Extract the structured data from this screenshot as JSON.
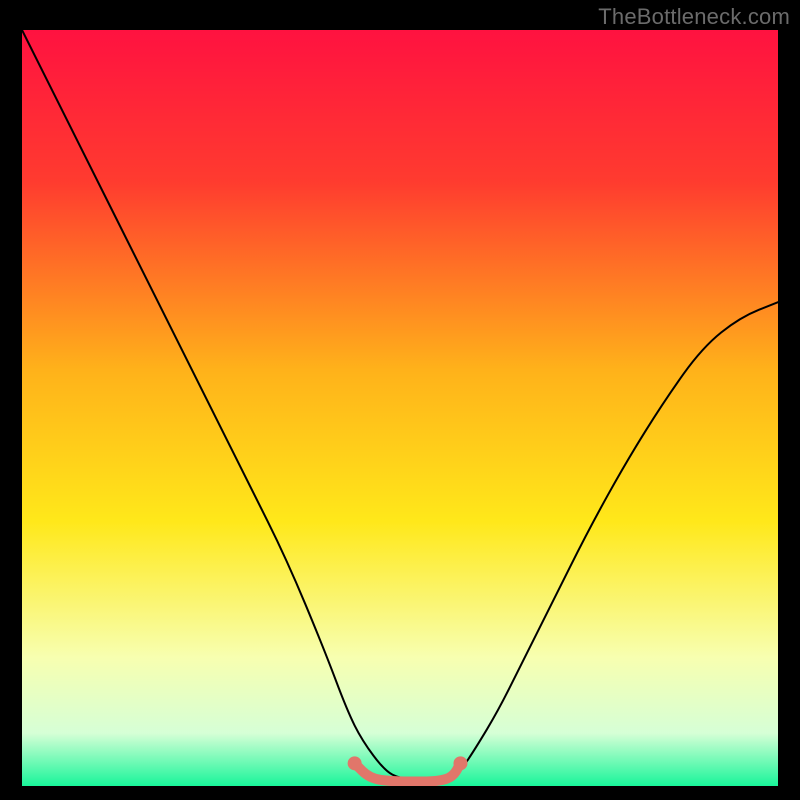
{
  "watermark": "TheBottleneck.com",
  "chart_data": {
    "type": "line",
    "title": "",
    "xlabel": "",
    "ylabel": "",
    "xlim": [
      0,
      100
    ],
    "ylim": [
      0,
      100
    ],
    "gradient_stops": [
      {
        "offset": 0,
        "color": "#ff1240"
      },
      {
        "offset": 20,
        "color": "#ff3b2f"
      },
      {
        "offset": 45,
        "color": "#ffb21a"
      },
      {
        "offset": 65,
        "color": "#ffe81a"
      },
      {
        "offset": 83,
        "color": "#f7ffb0"
      },
      {
        "offset": 93,
        "color": "#d6ffd6"
      },
      {
        "offset": 100,
        "color": "#19f59a"
      }
    ],
    "series": [
      {
        "name": "bottleneck-curve",
        "stroke": "#000000",
        "stroke_width": 2,
        "x": [
          0,
          5,
          10,
          15,
          20,
          25,
          30,
          35,
          40,
          43,
          45,
          48,
          50,
          52,
          55,
          58,
          60,
          63,
          66,
          70,
          75,
          80,
          85,
          90,
          95,
          100
        ],
        "y": [
          100,
          90,
          80,
          70,
          60,
          50,
          40,
          30,
          18,
          10,
          6,
          2,
          1,
          1,
          1,
          2,
          5,
          10,
          16,
          24,
          34,
          43,
          51,
          58,
          62,
          64
        ]
      },
      {
        "name": "flat-bottom-highlight",
        "stroke": "#e1766a",
        "stroke_width": 10,
        "x": [
          44,
          46,
          49,
          52,
          55,
          57,
          58
        ],
        "y": [
          3,
          1,
          0.6,
          0.6,
          0.6,
          1.2,
          3
        ]
      }
    ]
  }
}
